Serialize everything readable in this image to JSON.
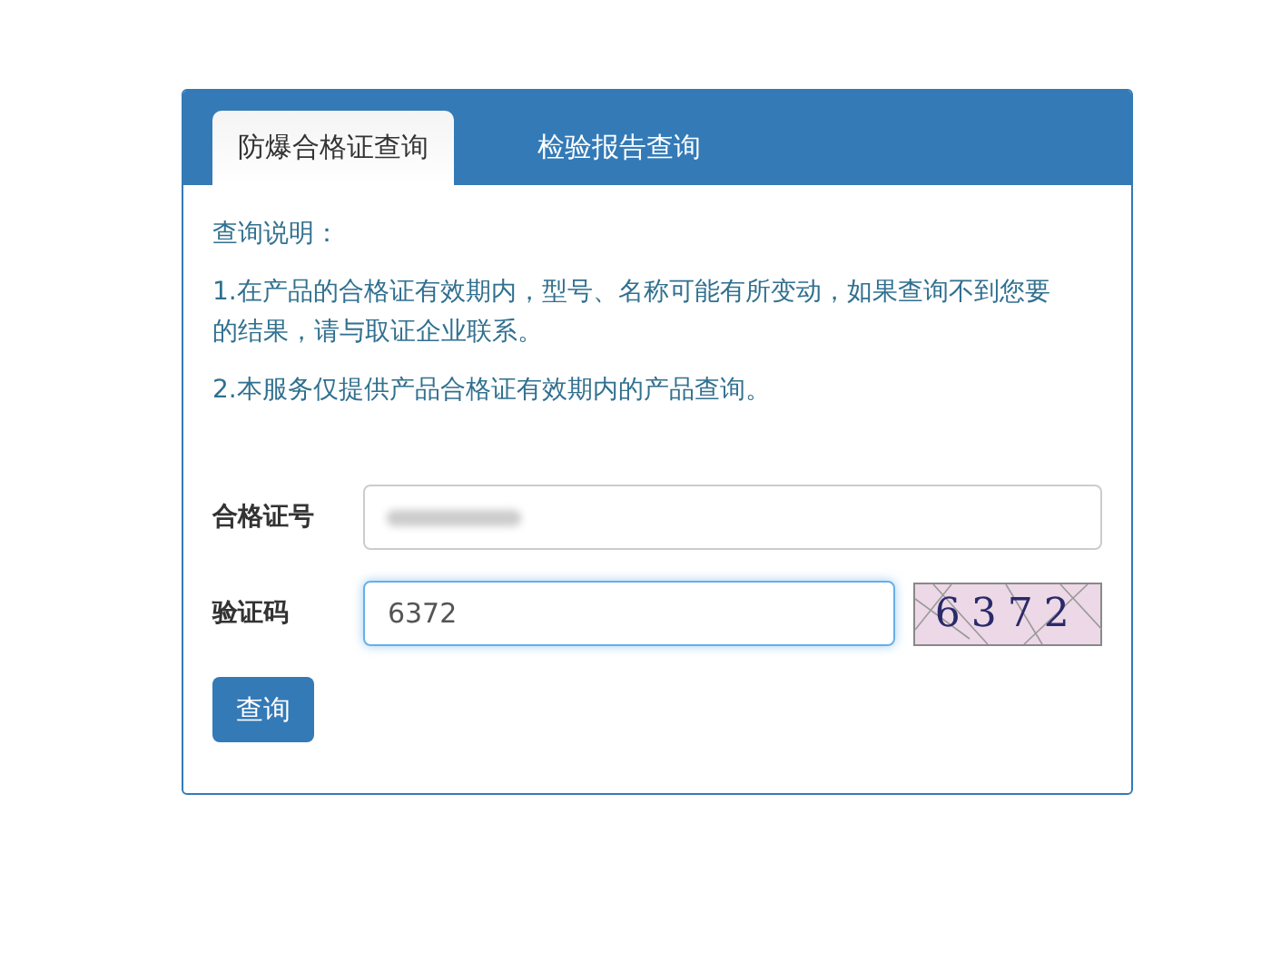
{
  "tabs": [
    {
      "label": "防爆合格证查询",
      "selected": true
    },
    {
      "label": "检验报告查询",
      "selected": false
    }
  ],
  "notes": [
    "查询说明：",
    "1.在产品的合格证有效期内，型号、名称可能有所变动，如果查询不到您要的结果，请与取证企业联系。",
    "2.本服务仅提供产品合格证有效期内的产品查询。"
  ],
  "form": {
    "certificate": {
      "label": "合格证号",
      "blurred": true
    },
    "captcha": {
      "label": "验证码",
      "value": "6372",
      "focused": true,
      "image_text": "6372"
    },
    "submit": "查询"
  }
}
